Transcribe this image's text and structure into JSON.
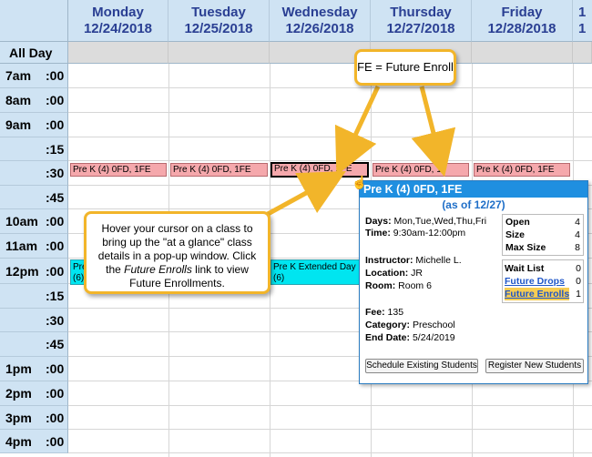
{
  "days": [
    {
      "name": "Monday",
      "date": "12/24/2018"
    },
    {
      "name": "Tuesday",
      "date": "12/25/2018"
    },
    {
      "name": "Wednesday",
      "date": "12/26/2018"
    },
    {
      "name": "Thursday",
      "date": "12/27/2018"
    },
    {
      "name": "Friday",
      "date": "12/28/2018"
    },
    {
      "name": "1",
      "date": "1"
    }
  ],
  "all_day_label": "All Day",
  "times": [
    {
      "hour": "7am",
      "min": ":00"
    },
    {
      "hour": "8am",
      "min": ":00"
    },
    {
      "hour": "9am",
      "min": ":00"
    },
    {
      "hour": "",
      "min": ":15"
    },
    {
      "hour": "",
      "min": ":30"
    },
    {
      "hour": "",
      "min": ":45"
    },
    {
      "hour": "10am",
      "min": ":00"
    },
    {
      "hour": "11am",
      "min": ":00"
    },
    {
      "hour": "12pm",
      "min": ":00"
    },
    {
      "hour": "",
      "min": ":15"
    },
    {
      "hour": "",
      "min": ":30"
    },
    {
      "hour": "",
      "min": ":45"
    },
    {
      "hour": "1pm",
      "min": ":00"
    },
    {
      "hour": "2pm",
      "min": ":00"
    },
    {
      "hour": "3pm",
      "min": ":00"
    },
    {
      "hour": "4pm",
      "min": ":00"
    }
  ],
  "events": {
    "prek": "Pre K (4) 0FD, 1FE",
    "prek_thu": "Pre K (4) 0FD, 1",
    "ext_mon": "Pre (6)",
    "ext_wed_line1": "Pre K Extended Day",
    "ext_wed_line2": "(6)"
  },
  "callout_fe": "FE = Future Enroll",
  "callout_hover": {
    "pre": "Hover your cursor on a class to bring up the \"at a glance\" class details in a pop-up window. Click the ",
    "em": "Future Enrolls",
    "post": " link to view Future Enrollments."
  },
  "popup": {
    "title": "Pre K (4) 0FD, 1FE",
    "as_of": "(as of 12/27)",
    "days_label": "Days:",
    "days_value": "Mon,Tue,Wed,Thu,Fri",
    "time_label": "Time:",
    "time_value": "9:30am-12:00pm",
    "instructor_label": "Instructor:",
    "instructor_value": "Michelle L.",
    "location_label": "Location:",
    "location_value": "JR",
    "room_label": "Room:",
    "room_value": "Room 6",
    "fee_label": "Fee:",
    "fee_value": "135",
    "category_label": "Category:",
    "category_value": "Preschool",
    "end_label": "End Date:",
    "end_value": "5/24/2019",
    "open_label": "Open",
    "open_value": "4",
    "size_label": "Size",
    "size_value": "4",
    "max_label": "Max Size",
    "max_value": "8",
    "wait_label": "Wait List",
    "wait_value": "0",
    "drops_label": "Future Drops",
    "drops_value": "0",
    "enrolls_label": "Future Enrolls",
    "enrolls_value": "1",
    "btn_schedule": "Schedule Existing Students",
    "btn_register": "Register New Students"
  },
  "colors": {
    "header": "#cfe3f3",
    "event": "#f5a8ac",
    "extended": "#00e5f0",
    "callout_border": "#f2b52a",
    "popup_title": "#1f8fe0"
  }
}
